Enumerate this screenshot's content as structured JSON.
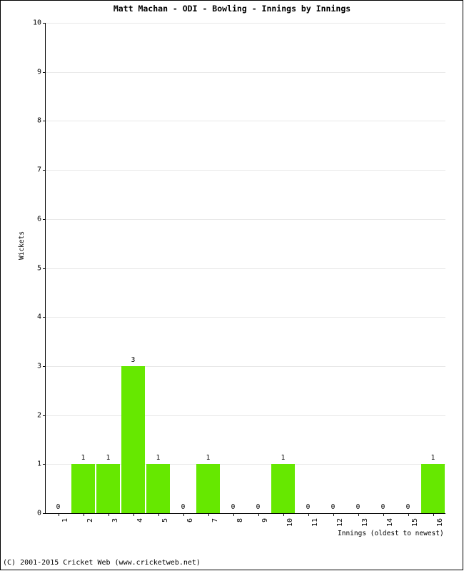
{
  "chart_data": {
    "type": "bar",
    "title": "Matt Machan - ODI - Bowling - Innings by Innings",
    "xlabel": "Innings (oldest to newest)",
    "ylabel": "Wickets",
    "categories": [
      "1",
      "2",
      "3",
      "4",
      "5",
      "6",
      "7",
      "8",
      "9",
      "10",
      "11",
      "12",
      "13",
      "14",
      "15",
      "16"
    ],
    "values": [
      0,
      1,
      1,
      3,
      1,
      0,
      1,
      0,
      0,
      1,
      0,
      0,
      0,
      0,
      0,
      1
    ],
    "data_labels": [
      "0",
      "1",
      "1",
      "3",
      "1",
      "0",
      "1",
      "0",
      "0",
      "1",
      "0",
      "0",
      "0",
      "0",
      "0",
      "1"
    ],
    "ylim": [
      0,
      10
    ],
    "yticks": [
      "0",
      "1",
      "2",
      "3",
      "4",
      "5",
      "6",
      "7",
      "8",
      "9",
      "10"
    ],
    "grid": true,
    "legend": "none",
    "bar_color": "#66e800"
  },
  "footer": {
    "copyright": "(C) 2001-2015 Cricket Web (www.cricketweb.net)"
  }
}
